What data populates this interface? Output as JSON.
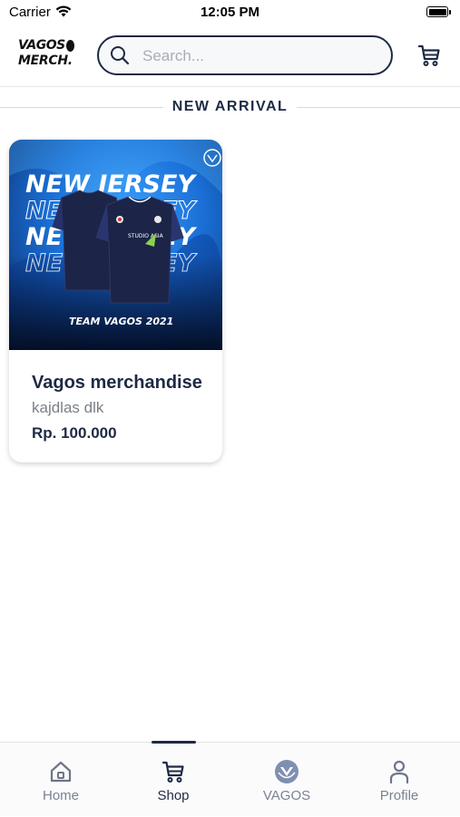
{
  "status_bar": {
    "carrier": "Carrier",
    "time": "12:05 PM"
  },
  "header": {
    "logo_line1": "VAGOS",
    "logo_line2": "MERCH.",
    "search_placeholder": "Search...",
    "search_value": ""
  },
  "section": {
    "title": "NEW ARRIVAL"
  },
  "products": [
    {
      "name": "Vagos merchandise",
      "description": "kajdlas dlk",
      "price": "Rp. 100.000",
      "image": {
        "headline_lines": [
          "NEW JERSEY",
          "NEW JERSEY",
          "NEW JERSEY",
          "NEW JERSEY"
        ],
        "caption": "TEAM VAGOS 2021",
        "sponsor": "STUDIO ASIA"
      }
    }
  ],
  "tabbar": {
    "tabs": [
      {
        "label": "Home",
        "icon": "home-icon",
        "active": false
      },
      {
        "label": "Shop",
        "icon": "cart-icon",
        "active": true
      },
      {
        "label": "VAGOS",
        "icon": "vagos-logo-icon",
        "active": false
      },
      {
        "label": "Profile",
        "icon": "user-icon",
        "active": false
      }
    ]
  },
  "colors": {
    "primary": "#1e2a44",
    "muted": "#7a8191",
    "image_blue": "#1a6fd6",
    "jersey_navy": "#1c2447"
  }
}
